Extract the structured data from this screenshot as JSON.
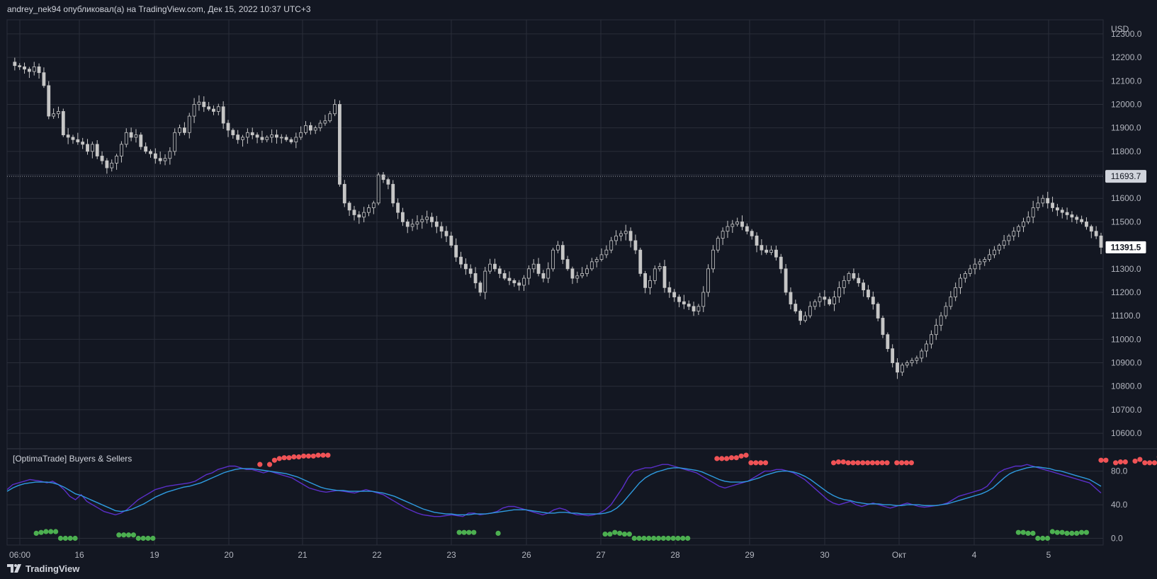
{
  "header": {
    "text": "andrey_nek94 опубликовал(а) на TradingView.com, Дек 15, 2022 10:37 UTC+3"
  },
  "footer": {
    "brand": "TradingView",
    "logo_icon": "tradingview-logo-icon"
  },
  "colors": {
    "background": "#131722",
    "grid": "#2a2e39",
    "candle": "#c6c6c6",
    "sellers_dot": "#f05356",
    "buyers_dot": "#4caf50",
    "fast_line": "#5b2fc9",
    "slow_line": "#2e9be0",
    "axis_text": "#b2b5be",
    "current_price_bg": "#ffffff",
    "current_price_text": "#131722",
    "dotted_price_bg": "#d1d4dc"
  },
  "chart_data": [
    {
      "type": "candlestick",
      "currency": "USD",
      "y_ticks": [
        10600,
        10700,
        10800,
        10900,
        11000,
        11100,
        11200,
        11300,
        11400,
        11500,
        11600,
        11700,
        11800,
        11900,
        12000,
        12100,
        12200,
        12300
      ],
      "y_tick_labels": [
        "10600.0",
        "10700.0",
        "10800.0",
        "10900.0",
        "11000.0",
        "11100.0",
        "11200.0",
        "11300.0",
        "11400.0",
        "11500.0",
        "11600.0",
        "11700.0",
        "11800.0",
        "11900.0",
        "12000.0",
        "12100.0",
        "12200.0",
        "12300.0"
      ],
      "ylim": [
        10540,
        12360
      ],
      "x_tick_labels": [
        "06:00",
        "16",
        "19",
        "20",
        "21",
        "22",
        "23",
        "26",
        "27",
        "28",
        "29",
        "30",
        "Окт",
        "4",
        "5"
      ],
      "price_markers": [
        {
          "label": "11693.7",
          "value": 11693.7,
          "style": "dotted"
        },
        {
          "label": "11391.5",
          "value": 11391.5,
          "style": "current"
        }
      ],
      "close_path": [
        12180,
        12165,
        12160,
        12150,
        12140,
        12160,
        12135,
        12080,
        11950,
        11960,
        11970,
        11870,
        11860,
        11850,
        11840,
        11830,
        11800,
        11830,
        11780,
        11760,
        11730,
        11750,
        11780,
        11830,
        11880,
        11860,
        11870,
        11820,
        11800,
        11790,
        11770,
        11760,
        11770,
        11800,
        11880,
        11900,
        11880,
        11950,
        12000,
        12010,
        11990,
        11980,
        11970,
        11990,
        11920,
        11890,
        11870,
        11850,
        11860,
        11880,
        11870,
        11860,
        11850,
        11860,
        11870,
        11860,
        11860,
        11850,
        11840,
        11860,
        11880,
        11910,
        11890,
        11900,
        11920,
        11930,
        11960,
        12000,
        11660,
        11580,
        11550,
        11530,
        11520,
        11540,
        11560,
        11580,
        11700,
        11680,
        11660,
        11580,
        11540,
        11500,
        11480,
        11490,
        11500,
        11510,
        11520,
        11500,
        11480,
        11460,
        11440,
        11400,
        11350,
        11320,
        11300,
        11280,
        11240,
        11200,
        11290,
        11320,
        11300,
        11280,
        11260,
        11250,
        11240,
        11230,
        11260,
        11300,
        11320,
        11280,
        11260,
        11300,
        11380,
        11400,
        11340,
        11300,
        11260,
        11270,
        11280,
        11300,
        11330,
        11340,
        11360,
        11380,
        11420,
        11440,
        11450,
        11460,
        11420,
        11380,
        11280,
        11220,
        11250,
        11300,
        11310,
        11220,
        11200,
        11180,
        11160,
        11150,
        11140,
        11120,
        11140,
        11200,
        11300,
        11380,
        11430,
        11460,
        11480,
        11490,
        11500,
        11480,
        11460,
        11440,
        11400,
        11380,
        11370,
        11380,
        11350,
        11300,
        11200,
        11150,
        11120,
        11080,
        11100,
        11140,
        11160,
        11180,
        11170,
        11150,
        11180,
        11220,
        11250,
        11280,
        11260,
        11240,
        11210,
        11180,
        11150,
        11090,
        11020,
        10960,
        10900,
        10860,
        10890,
        10900,
        10910,
        10920,
        10950,
        10980,
        11020,
        11060,
        11100,
        11140,
        11180,
        11220,
        11260,
        11280,
        11300,
        11320,
        11330,
        11340,
        11360,
        11380,
        11400,
        11420,
        11440,
        11460,
        11480,
        11500,
        11520,
        11560,
        11580,
        11600,
        11580,
        11560,
        11550,
        11540,
        11530,
        11520,
        11510,
        11500,
        11480,
        11460,
        11440,
        11391.5
      ]
    },
    {
      "type": "line",
      "title": "[OptimaTrade] Buyers & Sellers",
      "y_ticks": [
        0,
        40,
        80
      ],
      "y_tick_labels": [
        "0.0",
        "40.0",
        "80.0"
      ],
      "ylim": [
        -8,
        105
      ],
      "series": [
        {
          "color": "#5b2fc9",
          "values": [
            58,
            64,
            66,
            68,
            70,
            69,
            68,
            66,
            68,
            64,
            58,
            50,
            46,
            52,
            44,
            40,
            36,
            32,
            30,
            28,
            30,
            34,
            40,
            46,
            50,
            54,
            58,
            60,
            62,
            63,
            64,
            65,
            66,
            68,
            72,
            76,
            78,
            82,
            84,
            86,
            86,
            84,
            82,
            82,
            80,
            78,
            80,
            78,
            76,
            74,
            72,
            68,
            64,
            60,
            58,
            56,
            55,
            56,
            57,
            56,
            55,
            54,
            56,
            58,
            56,
            54,
            52,
            48,
            44,
            40,
            36,
            33,
            30,
            28,
            27,
            26,
            26,
            27,
            28,
            27,
            26,
            30,
            30,
            28,
            29,
            30,
            32,
            36,
            38,
            38,
            36,
            34,
            32,
            30,
            28,
            30,
            34,
            36,
            34,
            30,
            28,
            28,
            27,
            28,
            30,
            34,
            40,
            50,
            60,
            72,
            80,
            82,
            84,
            84,
            86,
            88,
            88,
            86,
            84,
            82,
            80,
            78,
            74,
            70,
            66,
            62,
            60,
            62,
            64,
            66,
            68,
            72,
            76,
            80,
            80,
            82,
            82,
            80,
            78,
            74,
            70,
            64,
            58,
            52,
            46,
            42,
            40,
            42,
            44,
            40,
            38,
            40,
            42,
            40,
            38,
            36,
            38,
            40,
            42,
            40,
            38,
            37,
            38,
            39,
            40,
            42,
            46,
            50,
            52,
            54,
            56,
            58,
            62,
            70,
            78,
            82,
            84,
            86,
            86,
            88,
            86,
            84,
            82,
            80,
            78,
            76,
            74,
            72,
            70,
            68,
            66,
            60,
            54
          ]
        },
        {
          "color": "#2e9be0",
          "values": [
            56,
            60,
            63,
            65,
            66,
            67,
            67,
            67,
            66,
            64,
            61,
            57,
            53,
            51,
            48,
            45,
            42,
            39,
            36,
            33,
            32,
            33,
            35,
            38,
            41,
            45,
            49,
            52,
            55,
            57,
            59,
            61,
            62,
            64,
            66,
            69,
            72,
            75,
            78,
            80,
            82,
            83,
            83,
            83,
            82,
            81,
            80,
            79,
            78,
            77,
            75,
            73,
            70,
            67,
            64,
            61,
            59,
            58,
            57,
            57,
            56,
            56,
            56,
            56,
            56,
            55,
            54,
            52,
            50,
            47,
            44,
            41,
            38,
            35,
            33,
            31,
            30,
            29,
            29,
            28,
            28,
            28,
            29,
            29,
            29,
            30,
            31,
            32,
            33,
            34,
            34,
            34,
            33,
            32,
            31,
            30,
            30,
            31,
            31,
            30,
            30,
            29,
            29,
            29,
            29,
            30,
            32,
            36,
            42,
            50,
            58,
            66,
            72,
            76,
            79,
            81,
            83,
            84,
            84,
            83,
            82,
            81,
            79,
            76,
            73,
            70,
            68,
            67,
            67,
            67,
            68,
            70,
            72,
            75,
            77,
            79,
            80,
            80,
            79,
            77,
            74,
            70,
            65,
            60,
            55,
            51,
            48,
            46,
            45,
            43,
            42,
            41,
            41,
            41,
            40,
            40,
            39,
            39,
            40,
            40,
            40,
            39,
            39,
            39,
            40,
            41,
            43,
            45,
            47,
            49,
            51,
            53,
            56,
            60,
            66,
            72,
            77,
            80,
            82,
            84,
            85,
            85,
            84,
            83,
            81,
            80,
            78,
            76,
            74,
            72,
            70,
            66,
            62
          ]
        }
      ],
      "sellers_dots": [
        [
          52,
          88
        ],
        [
          54,
          88
        ],
        [
          55,
          93
        ],
        [
          56,
          95
        ],
        [
          57,
          96
        ],
        [
          58,
          96
        ],
        [
          59,
          97
        ],
        [
          60,
          97
        ],
        [
          61,
          98
        ],
        [
          62,
          98
        ],
        [
          63,
          98
        ],
        [
          64,
          99
        ],
        [
          65,
          99
        ],
        [
          66,
          99
        ],
        [
          146,
          95
        ],
        [
          147,
          95
        ],
        [
          148,
          95
        ],
        [
          149,
          96
        ],
        [
          150,
          96
        ],
        [
          151,
          98
        ],
        [
          152,
          99
        ],
        [
          153,
          90
        ],
        [
          154,
          90
        ],
        [
          155,
          90
        ],
        [
          156,
          90
        ],
        [
          170,
          90
        ],
        [
          171,
          91
        ],
        [
          172,
          91
        ],
        [
          173,
          90
        ],
        [
          174,
          90
        ],
        [
          175,
          90
        ],
        [
          176,
          90
        ],
        [
          177,
          90
        ],
        [
          178,
          90
        ],
        [
          179,
          90
        ],
        [
          180,
          90
        ],
        [
          181,
          90
        ],
        [
          183,
          90
        ],
        [
          184,
          90
        ],
        [
          185,
          90
        ],
        [
          186,
          90
        ],
        [
          225,
          93
        ],
        [
          226,
          93
        ],
        [
          228,
          90
        ],
        [
          229,
          91
        ],
        [
          230,
          91
        ],
        [
          232,
          92
        ],
        [
          233,
          94
        ],
        [
          234,
          90
        ],
        [
          235,
          90
        ],
        [
          236,
          90
        ],
        [
          237,
          97
        ],
        [
          238,
          98
        ],
        [
          239,
          98
        ],
        [
          240,
          98
        ],
        [
          241,
          98
        ],
        [
          242,
          98
        ],
        [
          243,
          98
        ],
        [
          244,
          98
        ],
        [
          245,
          98
        ],
        [
          246,
          98
        ],
        [
          247,
          98
        ],
        [
          248,
          96
        ],
        [
          249,
          92
        ],
        [
          250,
          90
        ],
        [
          251,
          90
        ],
        [
          252,
          90
        ],
        [
          253,
          90
        ],
        [
          254,
          90
        ],
        [
          255,
          90
        ],
        [
          256,
          90
        ]
      ],
      "buyers_dots": [
        [
          6,
          6
        ],
        [
          7,
          7
        ],
        [
          8,
          8
        ],
        [
          9,
          8
        ],
        [
          10,
          8
        ],
        [
          11,
          0
        ],
        [
          12,
          0
        ],
        [
          13,
          0
        ],
        [
          14,
          0
        ],
        [
          23,
          4
        ],
        [
          24,
          4
        ],
        [
          25,
          4
        ],
        [
          26,
          4
        ],
        [
          27,
          0
        ],
        [
          28,
          0
        ],
        [
          29,
          0
        ],
        [
          30,
          0
        ],
        [
          93,
          7
        ],
        [
          94,
          7
        ],
        [
          95,
          7
        ],
        [
          96,
          7
        ],
        [
          101,
          6
        ],
        [
          123,
          5
        ],
        [
          124,
          5
        ],
        [
          125,
          7
        ],
        [
          126,
          6
        ],
        [
          127,
          5
        ],
        [
          128,
          5
        ],
        [
          129,
          0
        ],
        [
          130,
          0
        ],
        [
          131,
          0
        ],
        [
          132,
          0
        ],
        [
          133,
          0
        ],
        [
          134,
          0
        ],
        [
          135,
          0
        ],
        [
          136,
          0
        ],
        [
          137,
          0
        ],
        [
          138,
          0
        ],
        [
          139,
          0
        ],
        [
          140,
          0
        ],
        [
          208,
          7
        ],
        [
          209,
          7
        ],
        [
          210,
          6
        ],
        [
          211,
          6
        ],
        [
          212,
          0
        ],
        [
          213,
          0
        ],
        [
          214,
          0
        ],
        [
          215,
          8
        ],
        [
          216,
          7
        ],
        [
          217,
          7
        ],
        [
          218,
          6
        ],
        [
          219,
          6
        ],
        [
          220,
          6
        ],
        [
          221,
          7
        ],
        [
          222,
          7
        ]
      ]
    }
  ]
}
